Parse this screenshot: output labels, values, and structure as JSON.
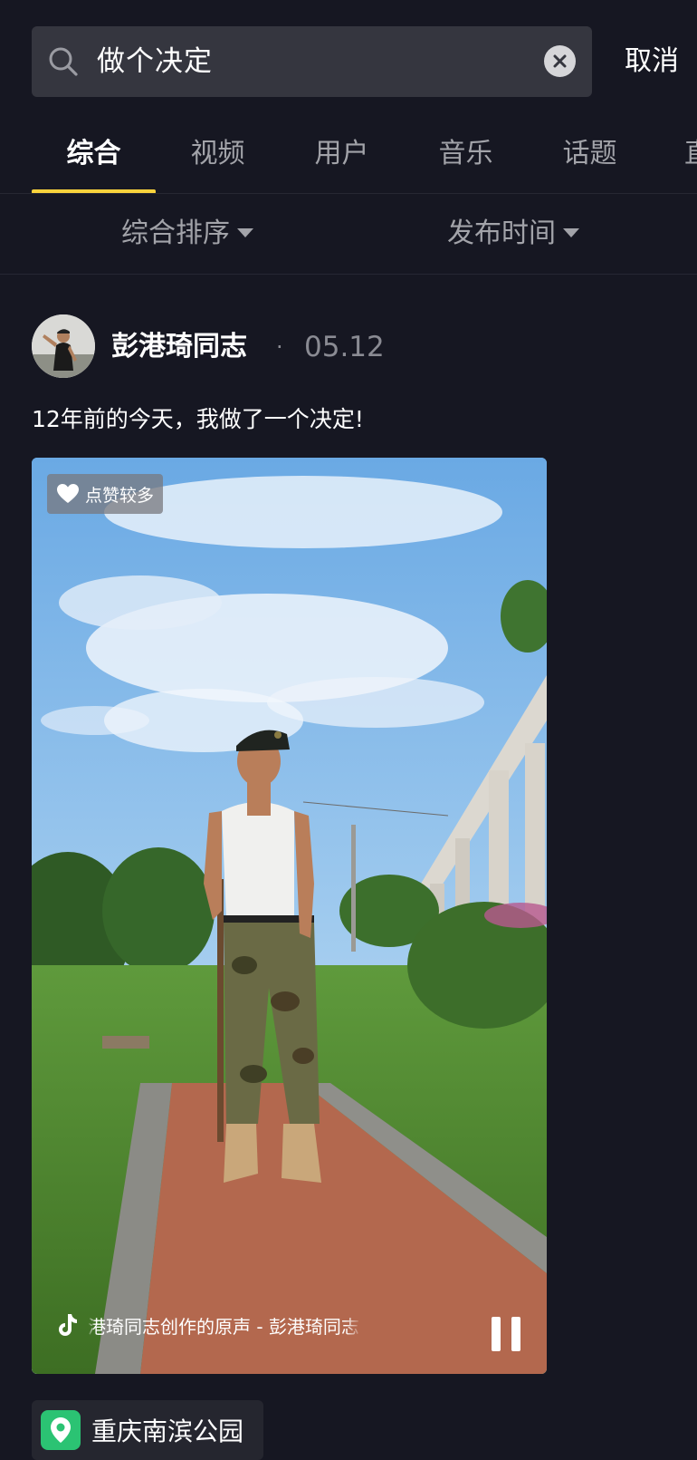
{
  "search": {
    "query": "做个决定",
    "cancel_label": "取消"
  },
  "tabs": [
    {
      "label": "综合",
      "active": true
    },
    {
      "label": "视频",
      "active": false
    },
    {
      "label": "用户",
      "active": false
    },
    {
      "label": "音乐",
      "active": false
    },
    {
      "label": "话题",
      "active": false
    },
    {
      "label": "直",
      "active": false
    }
  ],
  "sort": {
    "order_label": "综合排序",
    "time_label": "发布时间"
  },
  "post": {
    "author": "彭港琦同志",
    "separator": "·",
    "date": "05.12",
    "caption": "12年前的今天，我做了一个决定!",
    "badge": "点赞较多",
    "music": "港琦同志创作的原声 - 彭港琦同志",
    "location": "重庆南滨公园"
  },
  "colors": {
    "background": "#161722",
    "accent_underline": "#f9d23c",
    "location_icon": "#2bc373"
  }
}
